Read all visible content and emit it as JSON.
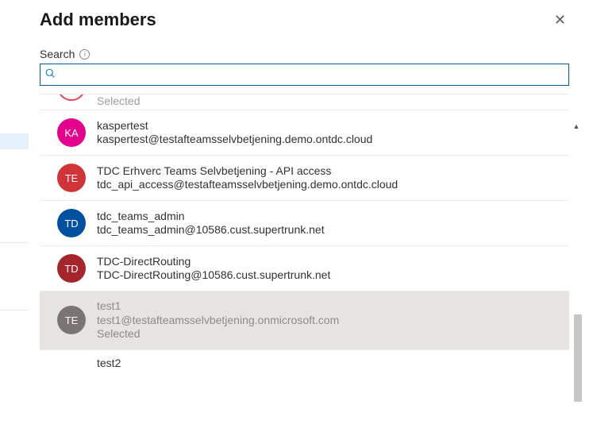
{
  "header": {
    "title": "Add members"
  },
  "search": {
    "label": "Search",
    "placeholder": ""
  },
  "partial_top": {
    "status": "Selected"
  },
  "items": [
    {
      "initials": "KA",
      "color": "#e3008c",
      "name": "kaspertest",
      "email": "kaspertest@testafteamsselvbetjening.demo.ontdc.cloud",
      "selected": false
    },
    {
      "initials": "TE",
      "color": "#d13438",
      "name": "TDC Erhverc Teams Selvbetjening - API access",
      "email": "tdc_api_access@testafteamsselvbetjening.demo.ontdc.cloud",
      "selected": false
    },
    {
      "initials": "TD",
      "color": "#0050a0",
      "name": "tdc_teams_admin",
      "email": "tdc_teams_admin@10586.cust.supertrunk.net",
      "selected": false
    },
    {
      "initials": "TD",
      "color": "#a4262c",
      "name": "TDC-DirectRouting",
      "email": "TDC-DirectRouting@10586.cust.supertrunk.net",
      "selected": false
    },
    {
      "initials": "TE",
      "color": "#7a7574",
      "name": "test1",
      "email": "test1@testafteamsselvbetjening.onmicrosoft.com",
      "selected": true,
      "status": "Selected"
    }
  ],
  "partial_bottom": {
    "name": "test2"
  }
}
